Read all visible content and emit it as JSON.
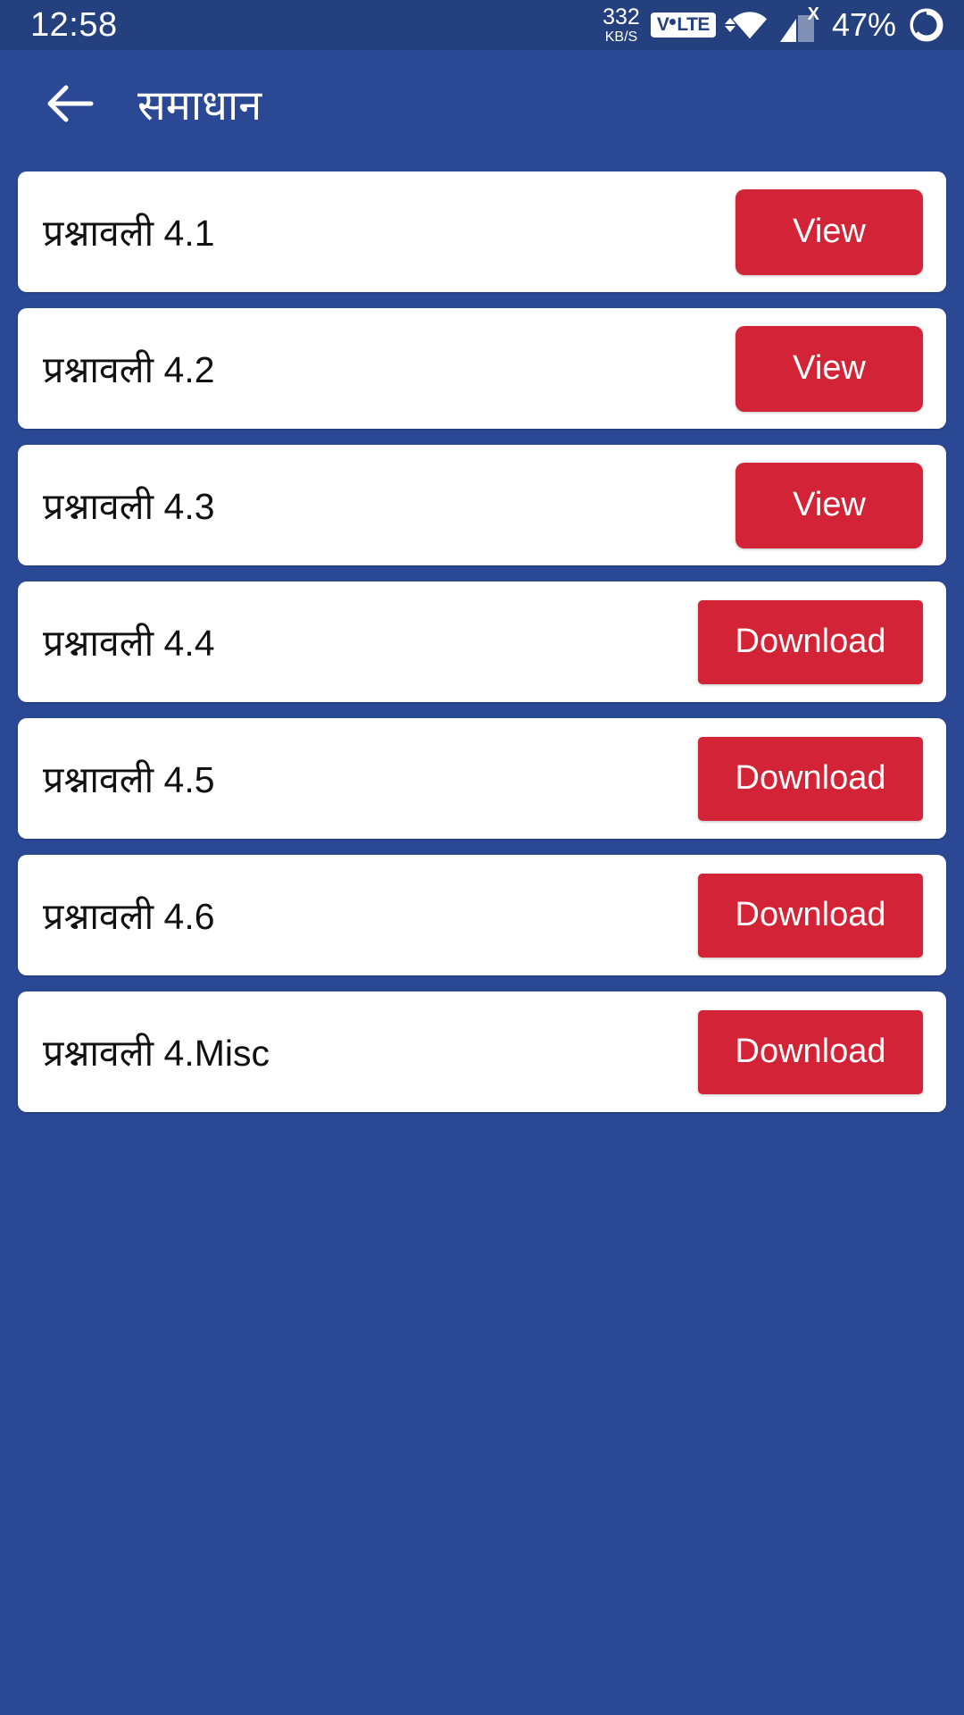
{
  "status_bar": {
    "time": "12:58",
    "net_speed_value": "332",
    "net_speed_unit": "KB/S",
    "volte_label_left": "V",
    "volte_label_right": "LTE",
    "wifi_icon": "wifi-icon",
    "signal_icon": "signal-bars-icon",
    "signal_badge": "X",
    "battery_percent": "47%",
    "battery_icon": "battery-ring-icon",
    "background_color": "#24407f"
  },
  "app_bar": {
    "back_icon": "back-arrow-icon",
    "title": "समाधान",
    "background_color": "#2a4894"
  },
  "theme": {
    "page_background": "#2a4894",
    "card_background": "#ffffff",
    "accent_red": "#d32336",
    "text_primary": "#111111",
    "text_on_accent": "#ffffff"
  },
  "list": {
    "items": [
      {
        "label": "प्रश्नावली 4.1",
        "action": "View",
        "action_type": "view"
      },
      {
        "label": "प्रश्नावली 4.2",
        "action": "View",
        "action_type": "view"
      },
      {
        "label": "प्रश्नावली 4.3",
        "action": "View",
        "action_type": "view"
      },
      {
        "label": "प्रश्नावली 4.4",
        "action": "Download",
        "action_type": "download"
      },
      {
        "label": "प्रश्नावली 4.5",
        "action": "Download",
        "action_type": "download"
      },
      {
        "label": "प्रश्नावली 4.6",
        "action": "Download",
        "action_type": "download"
      },
      {
        "label": "प्रश्नावली 4.Misc",
        "action": "Download",
        "action_type": "download"
      }
    ]
  }
}
